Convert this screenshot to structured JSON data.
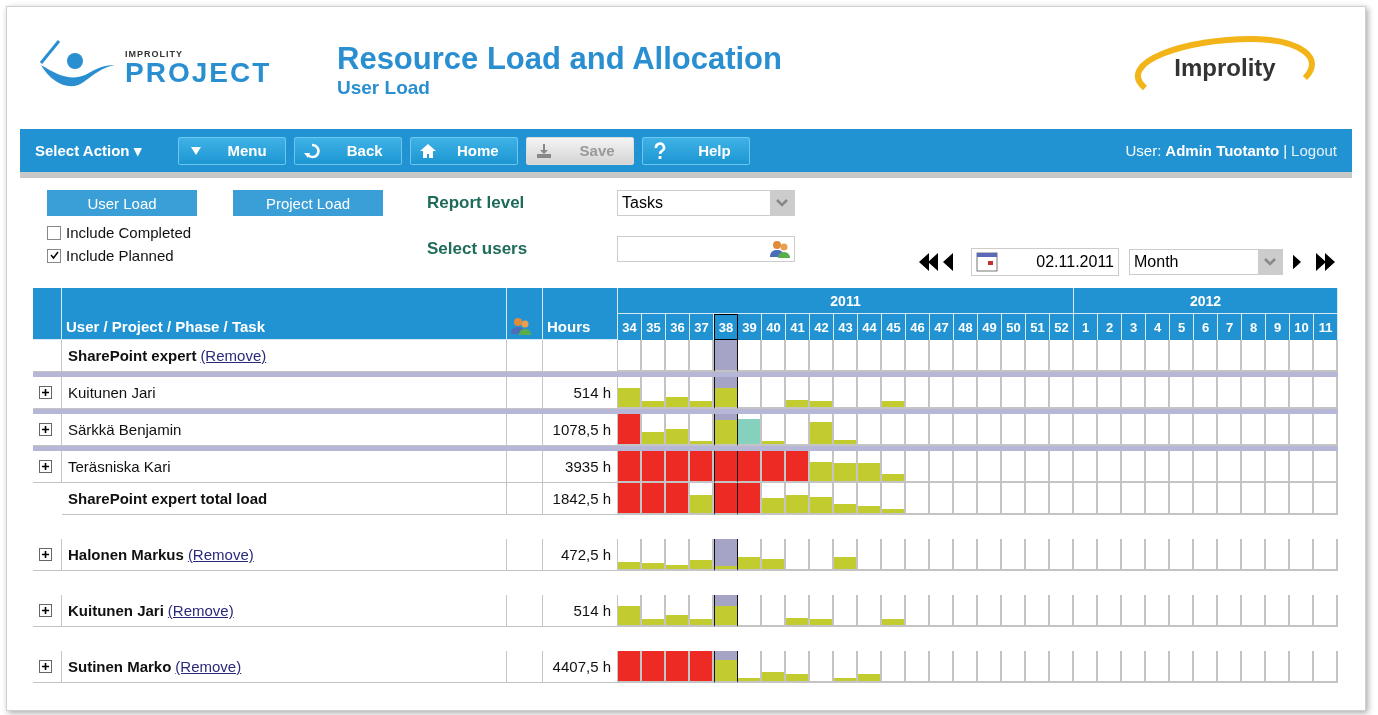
{
  "header": {
    "logo_small": "IMPROLITY",
    "logo_big": "PROJECT",
    "title": "Resource Load and Allocation",
    "subtitle": "User Load",
    "brand": "Improlity"
  },
  "toolbar": {
    "select_action": "Select Action ▾",
    "buttons": [
      {
        "label": "Menu",
        "kind": "menu",
        "disabled": false
      },
      {
        "label": "Back",
        "kind": "back",
        "disabled": false
      },
      {
        "label": "Home",
        "kind": "home",
        "disabled": false
      },
      {
        "label": "Save",
        "kind": "save",
        "disabled": true
      },
      {
        "label": "Help",
        "kind": "help",
        "disabled": false
      }
    ],
    "user_label": "User:",
    "user_name": "Admin Tuotanto",
    "separator": "|",
    "logout": "Logout"
  },
  "controls": {
    "load_buttons": [
      "User Load",
      "Project Load"
    ],
    "checkboxes": [
      {
        "label": "Include Completed",
        "checked": false
      },
      {
        "label": "Include Planned",
        "checked": true
      }
    ],
    "report_level_label": "Report level",
    "report_level": "Tasks",
    "select_users_label": "Select users",
    "date": "02.11.2011",
    "period": "Month"
  },
  "table": {
    "columns": [
      "User / Project / Phase / Task",
      "Hours"
    ],
    "years": [
      {
        "label": "2011",
        "weeks": [
          {
            "label": "34",
            "selected": false
          },
          {
            "label": "35",
            "selected": false
          },
          {
            "label": "36",
            "selected": false
          },
          {
            "label": "37",
            "selected": false
          },
          {
            "label": "38",
            "selected": true
          },
          {
            "label": "39",
            "selected": false
          },
          {
            "label": "40",
            "selected": false
          },
          {
            "label": "41",
            "selected": false
          },
          {
            "label": "42",
            "selected": false
          },
          {
            "label": "43",
            "selected": false
          },
          {
            "label": "44",
            "selected": false
          },
          {
            "label": "45",
            "selected": false
          },
          {
            "label": "46",
            "selected": false
          },
          {
            "label": "47",
            "selected": false
          },
          {
            "label": "48",
            "selected": false
          },
          {
            "label": "49",
            "selected": false
          },
          {
            "label": "50",
            "selected": false
          },
          {
            "label": "51",
            "selected": false
          },
          {
            "label": "52",
            "selected": false
          }
        ]
      },
      {
        "label": "2012",
        "weeks": [
          {
            "label": "1",
            "selected": false
          },
          {
            "label": "2",
            "selected": false
          },
          {
            "label": "3",
            "selected": false
          },
          {
            "label": "4",
            "selected": false
          },
          {
            "label": "5",
            "selected": false
          },
          {
            "label": "6",
            "selected": false
          },
          {
            "label": "7",
            "selected": false
          },
          {
            "label": "8",
            "selected": false
          },
          {
            "label": "9",
            "selected": false
          },
          {
            "label": "10",
            "selected": false
          },
          {
            "label": "11",
            "selected": false
          }
        ]
      }
    ],
    "groups": [
      {
        "name": "SharePoint expert",
        "remove": "(Remove)",
        "members": [
          {
            "name": "Kuitunen Jari",
            "hours": "514 h",
            "bars": [
              {
                "kind": "ok",
                "level": 0.65
              },
              {
                "kind": "ok",
                "level": 0.2
              },
              {
                "kind": "ok",
                "level": 0.35
              },
              {
                "kind": "ok",
                "level": 0.2
              },
              {
                "kind": "ok",
                "level": 0.65
              },
              {
                "kind": "empty"
              },
              {
                "kind": "empty"
              },
              {
                "kind": "ok",
                "level": 0.25
              },
              {
                "kind": "ok",
                "level": 0.2
              },
              {
                "kind": "empty"
              },
              {
                "kind": "empty"
              },
              {
                "kind": "ok",
                "level": 0.2
              }
            ]
          },
          {
            "name": "Särkkä Benjamin",
            "hours": "1078,5 h",
            "bars": [
              {
                "kind": "over",
                "level": 1
              },
              {
                "kind": "ok",
                "level": 0.4
              },
              {
                "kind": "ok",
                "level": 0.5
              },
              {
                "kind": "ok",
                "level": 0.1
              },
              {
                "kind": "ok",
                "level": 0.8
              },
              {
                "kind": "other",
                "level": 0.85
              },
              {
                "kind": "ok",
                "level": 0.1
              },
              {
                "kind": "empty"
              },
              {
                "kind": "ok",
                "level": 0.75
              },
              {
                "kind": "ok",
                "level": 0.15
              }
            ]
          },
          {
            "name": "Teräsniska Kari",
            "hours": "3935 h",
            "bars": [
              {
                "kind": "over",
                "level": 1
              },
              {
                "kind": "over",
                "level": 1
              },
              {
                "kind": "over",
                "level": 1
              },
              {
                "kind": "over",
                "level": 1
              },
              {
                "kind": "over",
                "level": 1
              },
              {
                "kind": "over",
                "level": 1
              },
              {
                "kind": "over",
                "level": 1
              },
              {
                "kind": "over",
                "level": 1
              },
              {
                "kind": "ok",
                "level": 0.65
              },
              {
                "kind": "ok",
                "level": 0.6
              },
              {
                "kind": "ok",
                "level": 0.6
              },
              {
                "kind": "ok",
                "level": 0.25
              }
            ]
          }
        ],
        "total": {
          "label": "SharePoint expert total load",
          "hours": "1842,5 h",
          "bars": [
            {
              "kind": "over",
              "level": 1
            },
            {
              "kind": "over",
              "level": 1
            },
            {
              "kind": "over",
              "level": 1
            },
            {
              "kind": "ok",
              "level": 0.6
            },
            {
              "kind": "over",
              "level": 1
            },
            {
              "kind": "over",
              "level": 1
            },
            {
              "kind": "ok",
              "level": 0.5
            },
            {
              "kind": "ok",
              "level": 0.6
            },
            {
              "kind": "ok",
              "level": 0.55
            },
            {
              "kind": "ok",
              "level": 0.3
            },
            {
              "kind": "ok",
              "level": 0.25
            },
            {
              "kind": "ok",
              "level": 0.15
            }
          ]
        }
      }
    ],
    "users": [
      {
        "name": "Halonen Markus",
        "remove": "(Remove)",
        "hours": "472,5 h",
        "bars": [
          {
            "kind": "ok",
            "level": 0.25
          },
          {
            "kind": "ok",
            "level": 0.2
          },
          {
            "kind": "ok",
            "level": 0.15
          },
          {
            "kind": "ok",
            "level": 0.3
          },
          {
            "kind": "ok",
            "level": 0.1
          },
          {
            "kind": "ok",
            "level": 0.4
          },
          {
            "kind": "ok",
            "level": 0.35
          },
          {
            "kind": "empty"
          },
          {
            "kind": "empty"
          },
          {
            "kind": "ok",
            "level": 0.4
          }
        ]
      },
      {
        "name": "Kuitunen Jari",
        "remove": "(Remove)",
        "hours": "514 h",
        "bars": [
          {
            "kind": "ok",
            "level": 0.65
          },
          {
            "kind": "ok",
            "level": 0.2
          },
          {
            "kind": "ok",
            "level": 0.35
          },
          {
            "kind": "ok",
            "level": 0.2
          },
          {
            "kind": "ok",
            "level": 0.65
          },
          {
            "kind": "empty"
          },
          {
            "kind": "empty"
          },
          {
            "kind": "ok",
            "level": 0.25
          },
          {
            "kind": "ok",
            "level": 0.2
          },
          {
            "kind": "empty"
          },
          {
            "kind": "empty"
          },
          {
            "kind": "ok",
            "level": 0.2
          }
        ]
      },
      {
        "name": "Sutinen Marko",
        "remove": "(Remove)",
        "hours": "4407,5 h",
        "bars": [
          {
            "kind": "over",
            "level": 1
          },
          {
            "kind": "over",
            "level": 1
          },
          {
            "kind": "over",
            "level": 1
          },
          {
            "kind": "over",
            "level": 1
          },
          {
            "kind": "ok",
            "level": 0.7
          },
          {
            "kind": "ok",
            "level": 0.1
          },
          {
            "kind": "ok",
            "level": 0.3
          },
          {
            "kind": "ok",
            "level": 0.25
          },
          {
            "kind": "empty"
          },
          {
            "kind": "ok",
            "level": 0.1
          },
          {
            "kind": "ok",
            "level": 0.25
          }
        ]
      }
    ]
  }
}
